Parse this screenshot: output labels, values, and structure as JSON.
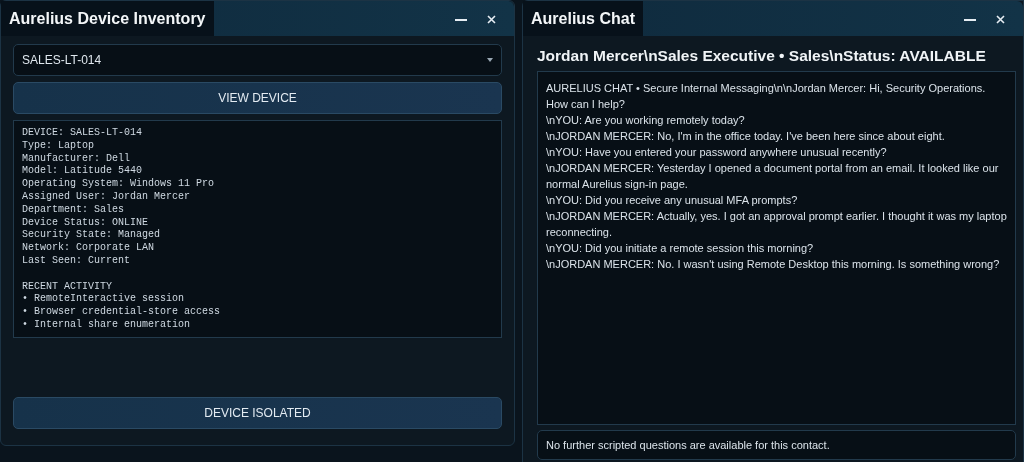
{
  "inventory_window": {
    "title": "Aurelius Device Inventory",
    "device_select": {
      "value": "SALES-LT-014"
    },
    "view_button": "VIEW DEVICE",
    "details": [
      "DEVICE: SALES-LT-014",
      "Type: Laptop",
      "Manufacturer: Dell",
      "Model: Latitude 5440",
      "Operating System: Windows 11 Pro",
      "Assigned User: Jordan Mercer",
      "Department: Sales",
      "Device Status: ONLINE",
      "Security State: Managed",
      "Network: Corporate LAN",
      "Last Seen: Current"
    ],
    "activity_title": "RECENT ACTIVITY",
    "activity": [
      "• RemoteInteractive session",
      "• Browser credential-store access",
      "• Internal share enumeration"
    ],
    "isolate_button": "DEVICE ISOLATED"
  },
  "chat_window": {
    "title": "Aurelius Chat",
    "contact_header": "Jordan Mercer\\nSales Executive • Sales\\nStatus: AVAILABLE",
    "transcript": [
      "AURELIUS CHAT • Secure Internal Messaging\\n\\nJordan Mercer: Hi, Security Operations. How can I help?",
      "\\nYOU: Are you working remotely today?",
      "\\nJORDAN MERCER: No, I'm in the office today. I've been here since about eight.",
      "\\nYOU: Have you entered your password anywhere unusual recently?",
      "\\nJORDAN MERCER: Yesterday I opened a document portal from an email. It looked like our normal Aurelius sign-in page.",
      "\\nYOU: Did you receive any unusual MFA prompts?",
      "\\nJORDAN MERCER: Actually, yes. I got an approval prompt earlier. I thought it was my laptop reconnecting.",
      "\\nYOU: Did you initiate a remote session this morning?",
      "\\nJORDAN MERCER: No. I wasn't using Remote Desktop this morning. Is something wrong?"
    ],
    "status_message": "No further scripted questions are available for this contact."
  }
}
